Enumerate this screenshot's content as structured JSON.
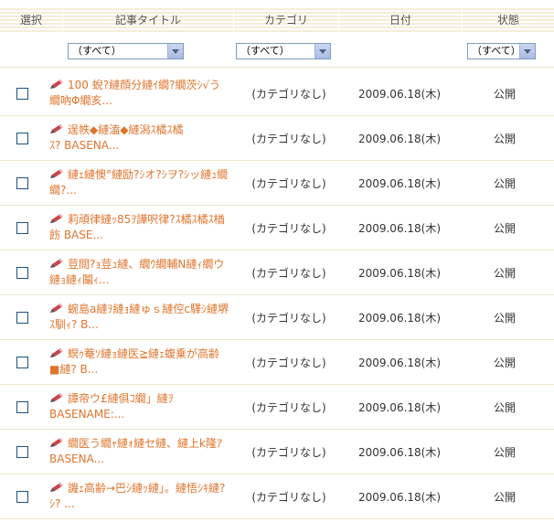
{
  "headers": {
    "select": "選択",
    "title": "記事タイトル",
    "category": "カテゴリ",
    "date": "日付",
    "status": "状態"
  },
  "filters": {
    "title": "（すべて）",
    "category": "（すべて）",
    "status": "（すべて）"
  },
  "colors": {
    "title_link": "#e0742c",
    "header_stripe": "#f7ecd7"
  },
  "rows": [
    {
      "title": "100 蜺?縺顔分縺ｲ繝?繝茨ｼ√う繝吶Φ繝亥...",
      "category": "(カテゴリなし)",
      "date": "2009.06.18(木)",
      "status": "公開"
    },
    {
      "title": "逞帙◆縺溘◆縺潟ｽ橘ｽ橘ｽ? BASENA...",
      "category": "(カテゴリなし)",
      "date": "2009.06.18(木)",
      "status": "公開"
    },
    {
      "title": "縺ｪ縺懊°縺励?ｼオ?ｼヲ?ｼッ縺ｭ繝繝?...",
      "category": "(カテゴリなし)",
      "date": "2009.06.18(木)",
      "status": "公開"
    },
    {
      "title": "莉頑律縺ｯ85ｦ譁呎律?ｽ橘ｽ橘ｽ楢飭 BASE...",
      "category": "(カテゴリなし)",
      "date": "2009.06.18(木)",
      "status": "公開"
    },
    {
      "title": "荳閲?ｮ荳ｭ縺、繝ｳ繝輔N縺ｨ繝ウ縺ｮ縺ｨ鬮ｨ...",
      "category": "(カテゴリなし)",
      "date": "2009.06.18(木)",
      "status": "公開"
    },
    {
      "title": "蜿島a縺ｦ縺ｮ縺ゅｓ縺倥c驛ｼ縺堺ｽ馴ｨ? B...",
      "category": "(カテゴリなし)",
      "date": "2009.06.18(木)",
      "status": "公開"
    },
    {
      "title": "螟ｩ菴ｿ縺ｮ縺医≧縺ｪ蝮乗が高齢■縺? B...",
      "category": "(カテゴリなし)",
      "date": "2009.06.18(木)",
      "status": "公開"
    },
    {
      "title": "譚帝ウ£縺俱ｺ繝」縺ｦ BASENAME:...",
      "category": "(カテゴリなし)",
      "date": "2009.06.18(木)",
      "status": "公開"
    },
    {
      "title": "繝医う繝ｬ縺ｫ縺セ縺、縺上k隆ｱBASENA...",
      "category": "(カテゴリなし)",
      "date": "2009.06.18(木)",
      "status": "公開"
    },
    {
      "title": "譏ｪ高齢→巴ｼ縺ｯ縺｣。縺悟ｼｷ縺?ｼ? ...",
      "category": "(カテゴリなし)",
      "date": "2009.06.18(木)",
      "status": "公開"
    }
  ]
}
